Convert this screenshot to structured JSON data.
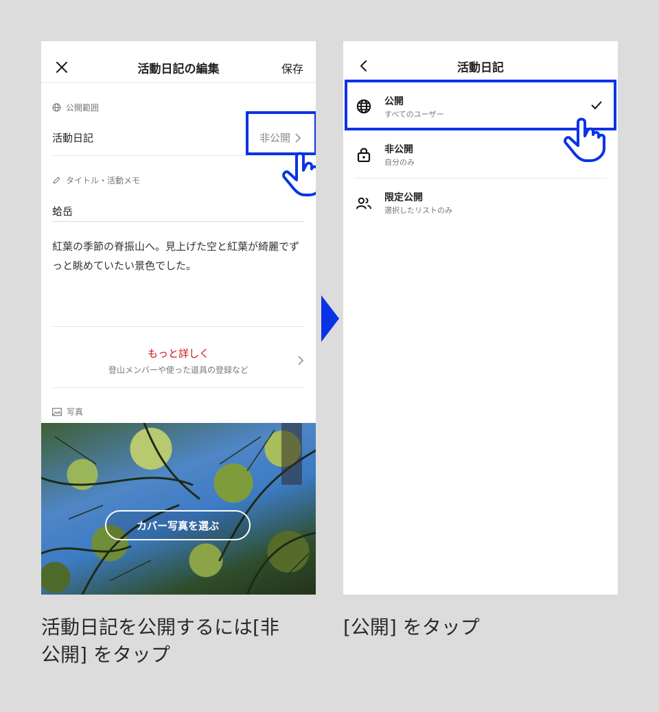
{
  "left_screen": {
    "header": {
      "close_icon": "close-icon",
      "title": "活動日記の編集",
      "save_label": "保存"
    },
    "visibility": {
      "section_label": "公開範囲",
      "row_label": "活動日記",
      "value": "非公開"
    },
    "title_memo": {
      "section_label": "タイトル・活動メモ",
      "title_value": "蛤岳",
      "memo": "紅葉の季節の脊振山へ。見上げた空と紅葉が綺麗でずっと眺めていたい景色でした。"
    },
    "more": {
      "label": "もっと詳しく",
      "sub": "登山メンバーや使った道具の登録など"
    },
    "photo": {
      "section_label": "写真",
      "cover_button": "カバー写真を選ぶ"
    }
  },
  "right_screen": {
    "header": {
      "back_icon": "chevron-left-icon",
      "title": "活動日記"
    },
    "options": [
      {
        "title": "公開",
        "sub": "すべてのユーザー",
        "icon": "globe-icon",
        "selected": true
      },
      {
        "title": "非公開",
        "sub": "自分のみ",
        "icon": "lock-icon",
        "selected": false
      },
      {
        "title": "限定公開",
        "sub": "選択したリストのみ",
        "icon": "users-icon",
        "selected": false
      }
    ]
  },
  "captions": {
    "left_line1": "活動日記を公開するには[非",
    "left_line2": "公開] をタップ",
    "right": "[公開] をタップ"
  },
  "colors": {
    "accent": "#0a33e6",
    "more_link": "#d0121b",
    "background": "#dcdcdc"
  }
}
